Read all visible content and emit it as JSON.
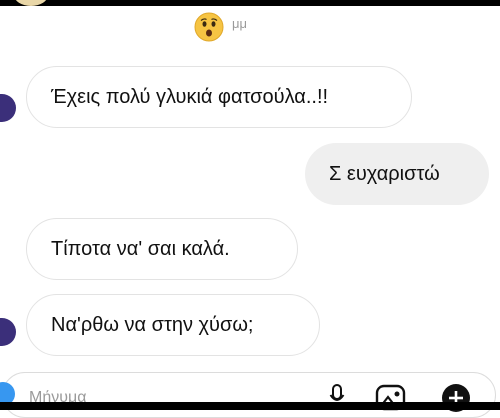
{
  "reaction": {
    "label": "μμ",
    "emoji_icon": "astonished-face-icon"
  },
  "messages": [
    {
      "direction": "incoming",
      "text": "Έχεις πολύ γλυκιά φατσούλα..!!"
    },
    {
      "direction": "outgoing",
      "text": "Σ ευχαριστώ"
    },
    {
      "direction": "incoming",
      "text": "Τίποτα να' σαι καλά."
    },
    {
      "direction": "incoming",
      "text": "Να'ρθω να στην χύσω;"
    }
  ],
  "composer": {
    "placeholder": "Μήνυμα",
    "icons": [
      "camera-icon",
      "microphone-icon",
      "gallery-icon",
      "add-icon"
    ]
  },
  "colors": {
    "avatar": "#3b2f7a",
    "outgoing_bubble": "#efefef",
    "accent": "#3797f0"
  }
}
